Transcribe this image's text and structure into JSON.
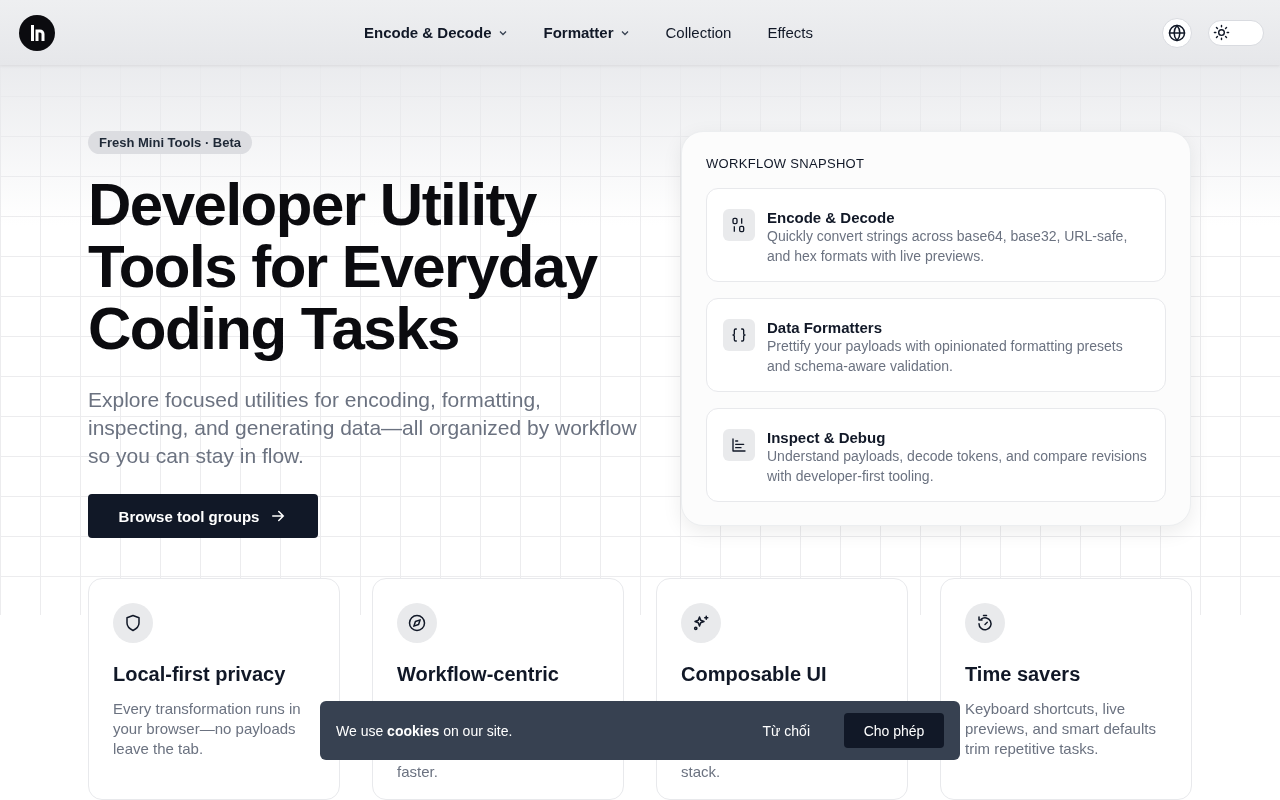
{
  "header": {
    "dark_mode": false,
    "nav": [
      {
        "label": "Encode & Decode",
        "kind": "dropdown"
      },
      {
        "label": "Formatter",
        "kind": "dropdown"
      },
      {
        "label": "Collection",
        "kind": "link"
      },
      {
        "label": "Effects",
        "kind": "link"
      }
    ]
  },
  "hero": {
    "badge": "Fresh Mini Tools · Beta",
    "title": "Developer Utility Tools for Everyday Coding Tasks",
    "lead": "Explore focused utilities for encoding, formatting, inspecting, and generating data—all organized by workflow so you can stay in flow.",
    "cta": "Browse tool groups"
  },
  "snapshot": {
    "heading": "WORKFLOW SNAPSHOT",
    "items": [
      {
        "kind": "binary",
        "title": "Encode & Decode",
        "text": "Quickly convert strings across base64, base32, URL-safe, and hex formats with live previews."
      },
      {
        "kind": "braces",
        "title": "Data Formatters",
        "text": "Prettify your payloads with opinionated formatting presets and schema-aware validation."
      },
      {
        "kind": "chart",
        "title": "Inspect & Debug",
        "text": "Understand payloads, decode tokens, and compare revisions with developer-first tooling."
      }
    ]
  },
  "features": [
    {
      "kind": "shield",
      "title": "Local-first privacy",
      "text": "Every transformation runs in your browser—no payloads leave the tab."
    },
    {
      "kind": "compass",
      "title": "Workflow-centric",
      "text": "faster."
    },
    {
      "kind": "sparkles",
      "title": "Composable UI",
      "text": "stack."
    },
    {
      "kind": "timer",
      "title": "Time savers",
      "text": "Keyboard shortcuts, live previews, and smart defaults trim repetitive tasks."
    }
  ],
  "cookie_banner": {
    "message": "We use **cookies** on our site.",
    "decline": "Từ chối",
    "accept": "Cho phép"
  }
}
